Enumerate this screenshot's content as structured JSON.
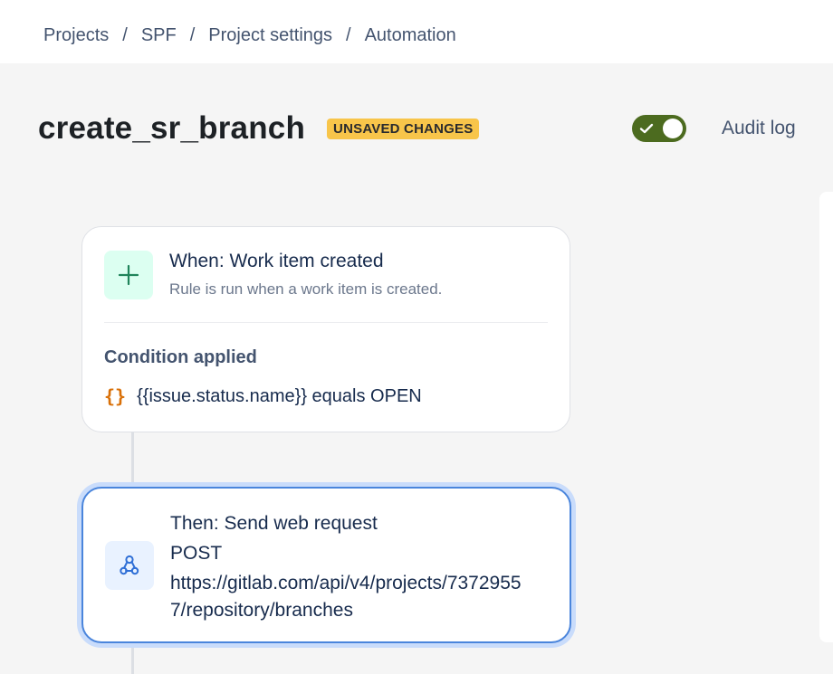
{
  "breadcrumb": {
    "items": [
      "Projects",
      "SPF",
      "Project settings",
      "Automation"
    ],
    "separator": "/"
  },
  "header": {
    "title": "create_sr_branch",
    "status_lozenge": "UNSAVED CHANGES",
    "rule_enabled": true,
    "audit_log_label": "Audit log"
  },
  "trigger": {
    "heading": "When: Work item created",
    "description": "Rule is run when a work item is created.",
    "icon": "plus-icon",
    "condition_title": "Condition applied",
    "condition_icon": "braces-icon",
    "condition_text": "{{issue.status.name}} equals OPEN"
  },
  "action": {
    "heading": "Then: Send web request",
    "icon": "webhook-icon",
    "method": "POST",
    "url": "https://gitlab.com/api/v4/projects/73729557/repository/branches"
  },
  "colors": {
    "toggle_on": "#4c6b1f",
    "lozenge": "#f8c54a",
    "selected_border": "#4a85dc",
    "trigger_tile": "#dcfff1",
    "action_tile": "#e9f2ff",
    "braces": "#d97008"
  }
}
